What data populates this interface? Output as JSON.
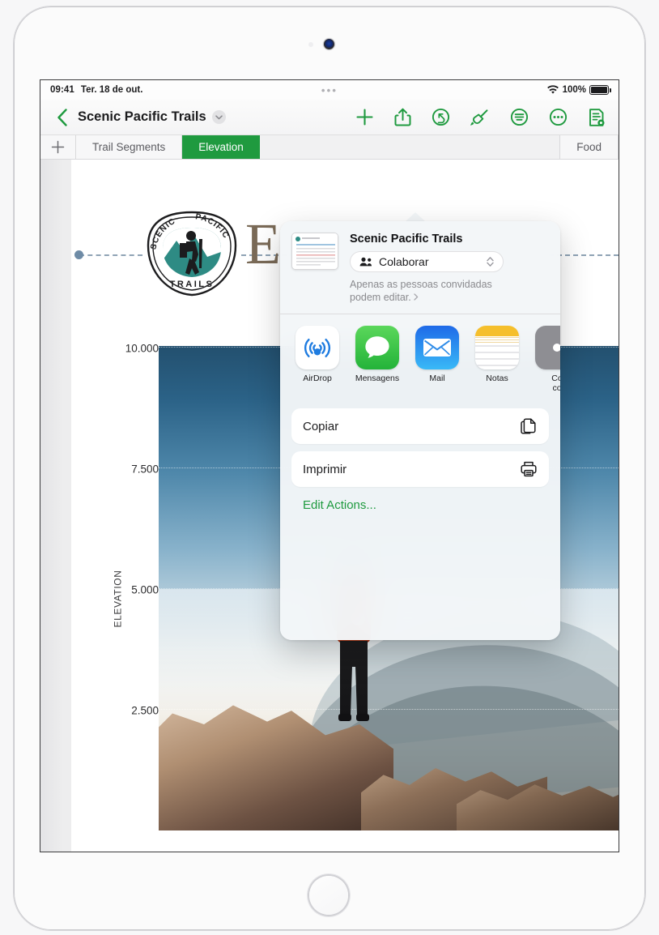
{
  "status_bar": {
    "time": "09:41",
    "date": "Ter. 18 de out.",
    "dots": "•••",
    "wifi_icon": "wifi-icon",
    "battery_percent": "100%",
    "battery_icon": "battery-icon"
  },
  "toolbar": {
    "back_icon": "back-chevron-icon",
    "document_title": "Scenic Pacific Trails",
    "title_chevron_icon": "chevron-down-icon",
    "buttons": [
      {
        "name": "insert-button",
        "icon": "plus-icon",
        "label": "+"
      },
      {
        "name": "share-button",
        "icon": "share-icon",
        "label": "Partilhar"
      },
      {
        "name": "undo-button",
        "icon": "undo-icon",
        "label": "Anular"
      },
      {
        "name": "format-button",
        "icon": "paintbrush-icon",
        "label": "Formatar"
      },
      {
        "name": "document-options-button",
        "icon": "document-options-icon",
        "label": "Opções"
      },
      {
        "name": "more-button",
        "icon": "ellipsis-icon",
        "label": "Mais"
      },
      {
        "name": "view-options-button",
        "icon": "document-view-icon",
        "label": "Ver"
      }
    ]
  },
  "tab_bar": {
    "add_icon": "plus-icon",
    "tabs": [
      {
        "label": "Trail Segments",
        "active": false
      },
      {
        "label": "Elevation",
        "active": true
      },
      {
        "label": "Food",
        "active": false
      }
    ]
  },
  "document": {
    "logo": {
      "top_left_text": "SCENIC",
      "top_right_text": "PACIFIC",
      "bottom_text": "TRAILS",
      "icon": "hiker-badge-icon"
    },
    "heading": "E"
  },
  "chart_data": {
    "type": "line",
    "title": "Elevation",
    "xlabel": "",
    "ylabel": "ELEVATION",
    "ylim": [
      0,
      10000
    ],
    "yticks": [
      10000,
      7500,
      5000,
      2500
    ],
    "ytick_labels": [
      "10.000",
      "7.500",
      "5.000",
      "2.500"
    ],
    "grid": true,
    "legend": "none",
    "categories": [],
    "values": [],
    "note": "Chart area is filled with a full-bleed photo of a hiker overlooking a mountain range."
  },
  "share_sheet": {
    "document_title": "Scenic Pacific Trails",
    "thumbnail_icon": "document-thumbnail-icon",
    "collaborate": {
      "people_icon": "people-icon",
      "label": "Colaborar",
      "chevron_icon": "chevron-up-down-icon"
    },
    "permission_note": "Apenas as pessoas convidadas podem editar.",
    "permission_chevron": "chevron-right-icon",
    "apps": [
      {
        "label": "AirDrop",
        "icon": "airdrop-icon"
      },
      {
        "label": "Mensagens",
        "icon": "messages-icon"
      },
      {
        "label": "Mail",
        "icon": "mail-icon"
      },
      {
        "label": "Notas",
        "icon": "notes-icon"
      },
      {
        "label": "Co\nco",
        "icon": "more-apps-icon"
      }
    ],
    "actions": [
      {
        "label": "Copiar",
        "icon": "copy-icon"
      },
      {
        "label": "Imprimir",
        "icon": "printer-icon"
      }
    ],
    "edit_actions_label": "Edit Actions..."
  },
  "colors": {
    "accent_green": "#1f9a3f",
    "active_tab_green": "#1f9a3f",
    "logo_teal": "#2e8b84",
    "heading_brown": "#7a6a57",
    "link_green": "#1f9a3f"
  },
  "device": {
    "home_button": "home-button",
    "camera": "front-camera"
  }
}
